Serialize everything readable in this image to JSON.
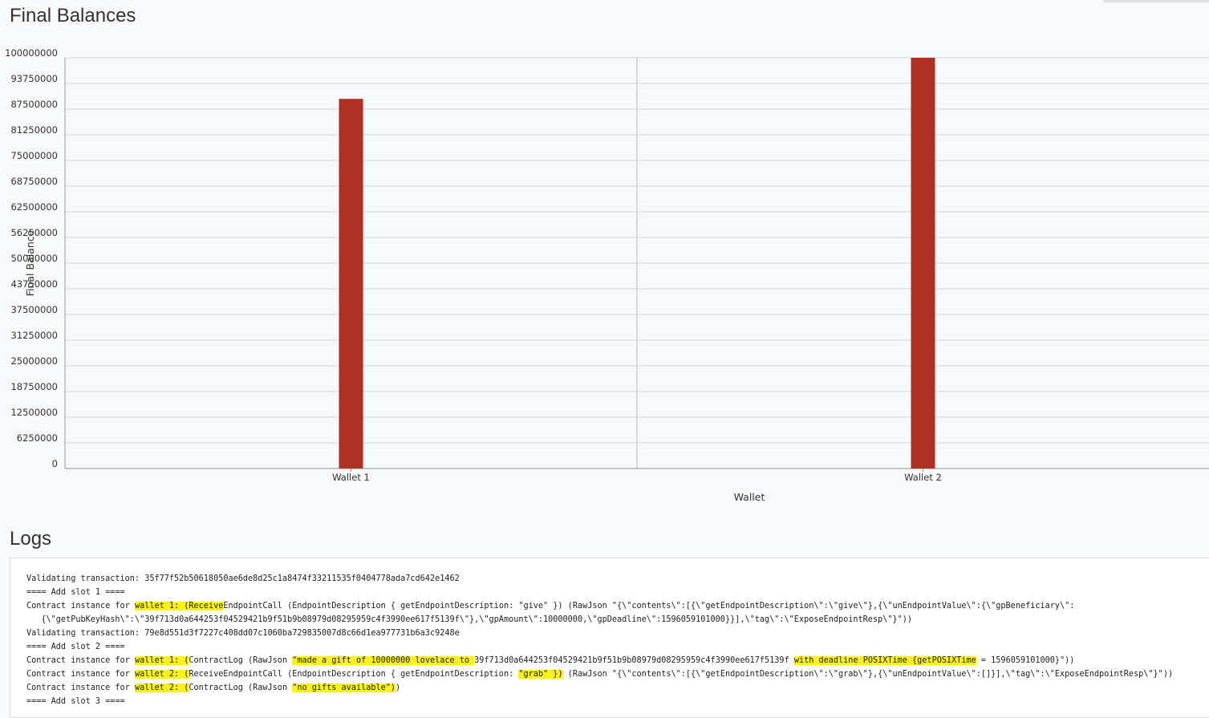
{
  "page": {
    "balances_title": "Final Balances",
    "logs_title": "Logs"
  },
  "chart_data": {
    "type": "bar",
    "title": "",
    "xlabel": "Wallet",
    "ylabel": "Final Balance",
    "ylim": [
      0,
      100000000
    ],
    "yticks": [
      0,
      6250000,
      12500000,
      18750000,
      25000000,
      31250000,
      37500000,
      43750000,
      50000000,
      56250000,
      62500000,
      68750000,
      75000000,
      81250000,
      87500000,
      93750000,
      100000000
    ],
    "categories": [
      "Wallet 1",
      "Wallet 2"
    ],
    "values": [
      90000000,
      100000000
    ],
    "bar_color": "#ae3025",
    "grid": true,
    "legend": "none"
  },
  "logs": {
    "lines": [
      [
        {
          "t": "Validating transaction: 35f77f52b50618050ae6de8d25c1a8474f33211535f0404778ada7cd642e1462"
        }
      ],
      [
        {
          "t": "==== Add slot 1 ===="
        }
      ],
      [
        {
          "t": "Contract instance for "
        },
        {
          "t": "wallet 1: (Receive",
          "h": true
        },
        {
          "t": "EndpointCall (EndpointDescription { getEndpointDescription: \"give\" }) (RawJson \"{\\\"contents\\\":[{\\\"getEndpointDescription\\\":\\\"give\\\"},{\\\"unEndpointValue\\\":{\\\"gpBeneficiary\\\":"
        }
      ],
      [
        {
          "t": "   {\\\"getPubKeyHash\\\":\\\"39f713d0a644253f04529421b9f51b9b08979d08295959c4f3990ee617f5139f\\\"},\\\"gpAmount\\\":10000000,\\\"gpDeadline\\\":1596059101000}}],\\\"tag\\\":\\\"ExposeEndpointResp\\\"}\"))"
        }
      ],
      [
        {
          "t": "Validating transaction: 79e8d551d3f7227c408dd07c1060ba729835007d8c66d1ea977731b6a3c9248e"
        }
      ],
      [
        {
          "t": "==== Add slot 2 ===="
        }
      ],
      [
        {
          "t": "Contract instance for "
        },
        {
          "t": "wallet 1: (",
          "h": true
        },
        {
          "t": "ContractLog (RawJson "
        },
        {
          "t": "\"made a gift of 10000000 lovelace to ",
          "h": true
        },
        {
          "t": "39f713d0a644253f04529421b9f51b9b08979d08295959c4f3990ee617f5139f "
        },
        {
          "t": "with deadline POSIXTime {getPOSIXTime",
          "h": true
        },
        {
          "t": " = 1596059101000}\"))"
        }
      ],
      [
        {
          "t": "Contract instance for "
        },
        {
          "t": "wallet 2: (",
          "h": true
        },
        {
          "t": "ReceiveEndpointCall (EndpointDescription { getEndpointDescription: "
        },
        {
          "t": "\"grab\" })",
          "h": true
        },
        {
          "t": " (RawJson \"{\\\"contents\\\":[{\\\"getEndpointDescription\\\":\\\"grab\\\"},{\\\"unEndpointValue\\\":[]}],\\\"tag\\\":\\\"ExposeEndpointResp\\\"}\"))"
        }
      ],
      [
        {
          "t": "Contract instance for "
        },
        {
          "t": "wallet 2: (",
          "h": true
        },
        {
          "t": "ContractLog (RawJson "
        },
        {
          "t": "\"no gifts available\")",
          "h": true
        },
        {
          "t": ")"
        }
      ],
      [
        {
          "t": "==== Add slot 3 ===="
        }
      ]
    ]
  }
}
